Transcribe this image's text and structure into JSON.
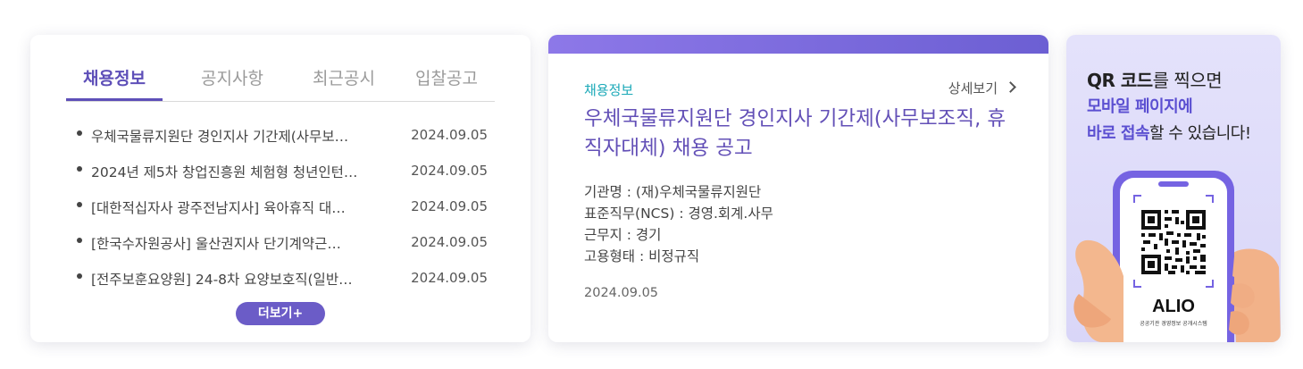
{
  "tabs": [
    {
      "label": "채용정보",
      "active": true
    },
    {
      "label": "공지사항",
      "active": false
    },
    {
      "label": "최근공시",
      "active": false
    },
    {
      "label": "입찰공고",
      "active": false
    }
  ],
  "notices": [
    {
      "title": "우체국물류지원단 경인지사 기간제(사무보…",
      "date": "2024.09.05"
    },
    {
      "title": "2024년 제5차 창업진흥원 체험형 청년인턴…",
      "date": "2024.09.05"
    },
    {
      "title": "[대한적십자사 광주전남지사] 육아휴직 대…",
      "date": "2024.09.05"
    },
    {
      "title": "[한국수자원공사] 울산권지사 단기계약근…",
      "date": "2024.09.05"
    },
    {
      "title": "[전주보훈요양원] 24-8차 요양보호직(일반…",
      "date": "2024.09.05"
    }
  ],
  "more_label": "더보기+",
  "featured": {
    "category": "채용정보",
    "detail_label": "상세보기",
    "title": "우체국물류지원단 경인지사 기간제(사무보조직, 휴직자대체) 채용 공고",
    "org": "기관명 : (재)우체국물류지원단",
    "job": "표준직무(NCS) : 경영.회계.사무",
    "location": "근무지 : 경기",
    "employment": "고용형태 : 비정규직",
    "date": "2024.09.05"
  },
  "qr_promo": {
    "line1_bold": "QR 코드",
    "line1_rest": "를 찍으면",
    "line2": "모바일 페이지에",
    "line3_highlight": "바로 접속",
    "line3_rest": "할 수 있습니다!",
    "brand": "ALIO",
    "brand_sub": "공공기관 경영정보 공개시스템"
  },
  "colors": {
    "accent": "#5e4fb8",
    "teal": "#1ba9b8",
    "qr_bg": "#dedcf9"
  }
}
